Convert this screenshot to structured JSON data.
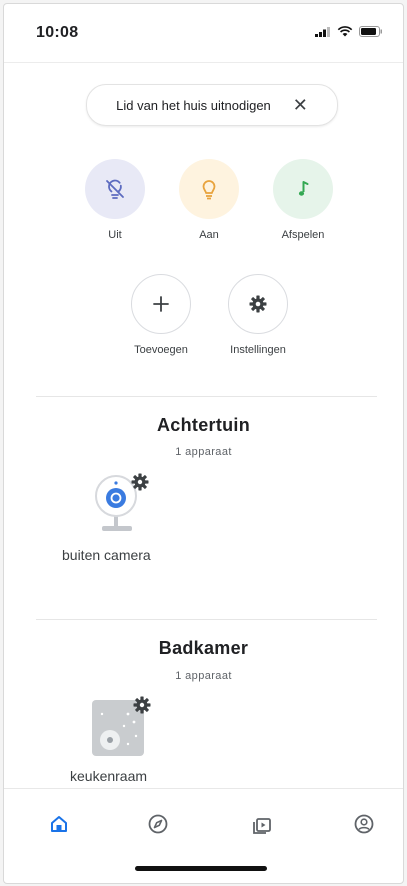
{
  "status_bar": {
    "time": "10:08"
  },
  "invite_chip": {
    "label": "Lid van het huis uitnodigen",
    "close_glyph": "✕"
  },
  "quick_actions": [
    {
      "label": "Uit",
      "icon": "light-off-icon",
      "bg": "#e8e9f6",
      "color": "#5c6bc0"
    },
    {
      "label": "Aan",
      "icon": "lightbulb-icon",
      "bg": "#fef3df",
      "color": "#e8a33d"
    },
    {
      "label": "Afspelen",
      "icon": "music-note-icon",
      "bg": "#e6f4ea",
      "color": "#34a853"
    }
  ],
  "secondary_actions": [
    {
      "label": "Toevoegen",
      "icon": "plus-icon"
    },
    {
      "label": "Instellingen",
      "icon": "gear-icon"
    }
  ],
  "rooms": [
    {
      "title": "Achtertuin",
      "count": "1 apparaat",
      "device": {
        "name": "buiten camera",
        "icon": "camera-icon"
      }
    },
    {
      "title": "Badkamer",
      "count": "1 apparaat",
      "device": {
        "name": "keukenraam",
        "icon": "window-sensor-icon"
      }
    }
  ],
  "bottom_nav": [
    {
      "name": "home",
      "icon": "home-icon",
      "active": true
    },
    {
      "name": "discover",
      "icon": "compass-icon",
      "active": false
    },
    {
      "name": "media",
      "icon": "media-icon",
      "active": false
    },
    {
      "name": "account",
      "icon": "account-icon",
      "active": false
    }
  ],
  "colors": {
    "accent": "#1a73e8",
    "icon_gray": "#5f6368"
  }
}
